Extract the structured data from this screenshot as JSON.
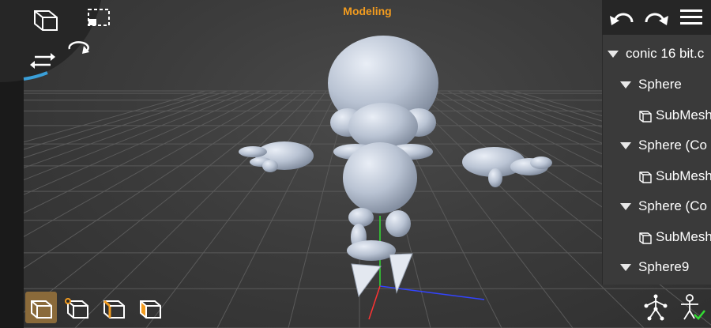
{
  "header": {
    "mode_title": "Modeling"
  },
  "colors": {
    "accent": "#f39c1f",
    "axis_x": "#3344ff",
    "axis_y": "#33dd33",
    "axis_z": "#ff3333",
    "model": "#b8c2d2"
  },
  "hierarchy": {
    "items": [
      {
        "label": "conic 16 bit.c",
        "type": "group"
      },
      {
        "label": "Sphere",
        "type": "group"
      },
      {
        "label": "SubMesh",
        "type": "mesh"
      },
      {
        "label": "Sphere (Co",
        "type": "group"
      },
      {
        "label": "SubMesh",
        "type": "mesh"
      },
      {
        "label": "Sphere (Co",
        "type": "group"
      },
      {
        "label": "SubMesh",
        "type": "mesh"
      },
      {
        "label": "Sphere9",
        "type": "group"
      }
    ]
  },
  "icons": {
    "top_left": [
      "cube-icon",
      "select-box-icon",
      "swap-arrows-icon",
      "rotate-view-icon"
    ],
    "top_right": [
      "undo-icon",
      "redo-icon",
      "menu-icon"
    ],
    "selection_modes": [
      "object-mode-icon",
      "vertex-mode-icon",
      "edge-mode-icon",
      "face-mode-icon"
    ],
    "bottom_right": [
      "skeleton-icon",
      "pose-check-icon"
    ]
  }
}
